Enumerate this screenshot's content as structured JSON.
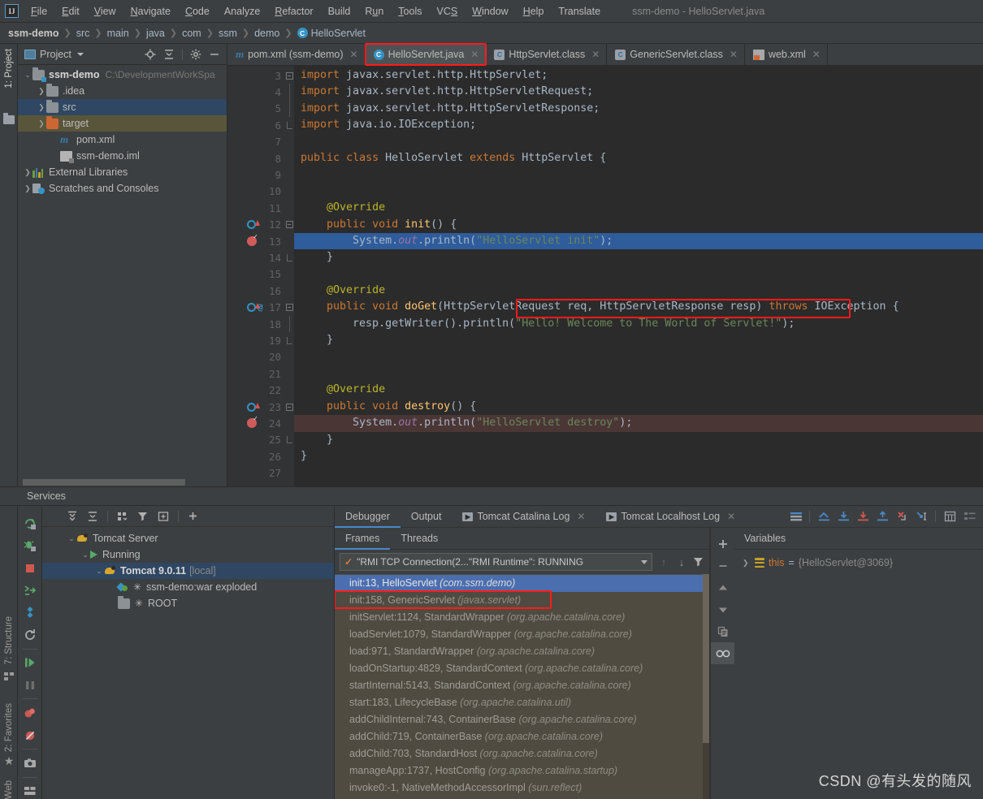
{
  "menu": {
    "logo": "IJ",
    "items": [
      "File",
      "Edit",
      "View",
      "Navigate",
      "Code",
      "Analyze",
      "Refactor",
      "Build",
      "Run",
      "Tools",
      "VCS",
      "Window",
      "Help",
      "Translate"
    ],
    "window_title": "ssm-demo - HelloServlet.java"
  },
  "breadcrumbs": {
    "items": [
      "ssm-demo",
      "src",
      "main",
      "java",
      "com",
      "ssm",
      "demo"
    ],
    "last": "HelloServlet",
    "class_icon_letter": "C"
  },
  "left_strip": {
    "project_label": "1: Project"
  },
  "project": {
    "title": "Project",
    "tree": [
      {
        "indent": 0,
        "arrow": "v",
        "icon": "module-folder",
        "name": "ssm-demo",
        "bold": true,
        "path": "C:\\DevelopmentWorkSpa",
        "state": "normal"
      },
      {
        "indent": 1,
        "arrow": ">",
        "icon": "folder",
        "name": ".idea",
        "bold": false,
        "path": "",
        "state": "normal"
      },
      {
        "indent": 1,
        "arrow": ">",
        "icon": "folder",
        "name": "src",
        "bold": false,
        "path": "",
        "state": "selected-blue"
      },
      {
        "indent": 1,
        "arrow": ">",
        "icon": "folder-orange",
        "name": "target",
        "bold": false,
        "path": "",
        "state": "selected-olive"
      },
      {
        "indent": 2,
        "arrow": "",
        "icon": "maven",
        "name": "pom.xml",
        "bold": false,
        "path": "",
        "state": "normal"
      },
      {
        "indent": 2,
        "arrow": "",
        "icon": "iml",
        "name": "ssm-demo.iml",
        "bold": false,
        "path": "",
        "state": "normal"
      },
      {
        "indent": 0,
        "arrow": ">",
        "icon": "libraries",
        "name": "External Libraries",
        "bold": false,
        "path": "",
        "state": "normal"
      },
      {
        "indent": 0,
        "arrow": ">",
        "icon": "scratches",
        "name": "Scratches and Consoles",
        "bold": false,
        "path": "",
        "state": "normal"
      }
    ]
  },
  "editor": {
    "tabs": [
      {
        "icon": "maven",
        "label": "pom.xml (ssm-demo)",
        "active": false,
        "closable": true
      },
      {
        "icon": "class-blue",
        "label": "HelloServlet.java",
        "active": true,
        "closable": true,
        "highlighted": true
      },
      {
        "icon": "class-file",
        "label": "HttpServlet.class",
        "active": false,
        "closable": true
      },
      {
        "icon": "class-file",
        "label": "GenericServlet.class",
        "active": false,
        "closable": true
      },
      {
        "icon": "xml",
        "label": "web.xml",
        "active": false,
        "closable": true
      }
    ],
    "first_visible_line": 3,
    "lines": [
      {
        "n": 3,
        "gutter": [],
        "fold": "minus",
        "highlight": "none",
        "text": "import javax.servlet.http.HttpServlet;"
      },
      {
        "n": 4,
        "gutter": [],
        "fold": "bar",
        "highlight": "none",
        "text": "import javax.servlet.http.HttpServletRequest;"
      },
      {
        "n": 5,
        "gutter": [],
        "fold": "bar",
        "highlight": "none",
        "text": "import javax.servlet.http.HttpServletResponse;"
      },
      {
        "n": 6,
        "gutter": [],
        "fold": "end",
        "highlight": "none",
        "text": "import java.io.IOException;"
      },
      {
        "n": 7,
        "gutter": [],
        "fold": "",
        "highlight": "none",
        "text": ""
      },
      {
        "n": 8,
        "gutter": [],
        "fold": "",
        "highlight": "none",
        "text": "public class HelloServlet extends HttpServlet {"
      },
      {
        "n": 9,
        "gutter": [],
        "fold": "",
        "highlight": "none",
        "text": ""
      },
      {
        "n": 10,
        "gutter": [],
        "fold": "",
        "highlight": "none",
        "text": ""
      },
      {
        "n": 11,
        "gutter": [],
        "fold": "",
        "highlight": "none",
        "text": "    @Override"
      },
      {
        "n": 12,
        "gutter": [
          "override"
        ],
        "fold": "minus",
        "highlight": "none",
        "text": "    public void init() {"
      },
      {
        "n": 13,
        "gutter": [
          "breakpoint-checked"
        ],
        "fold": "",
        "highlight": "blue",
        "text": "        System.out.println(\"HelloServlet init\");"
      },
      {
        "n": 14,
        "gutter": [],
        "fold": "end",
        "highlight": "none",
        "text": "    }"
      },
      {
        "n": 15,
        "gutter": [],
        "fold": "",
        "highlight": "none",
        "text": ""
      },
      {
        "n": 16,
        "gutter": [],
        "fold": "",
        "highlight": "none",
        "text": "    @Override"
      },
      {
        "n": 17,
        "gutter": [
          "override",
          "at"
        ],
        "fold": "minus",
        "highlight": "none",
        "text": "    public void doGet(HttpServletRequest req, HttpServletResponse resp) throws IOException {"
      },
      {
        "n": 18,
        "gutter": [],
        "fold": "bar",
        "highlight": "none",
        "text": "        resp.getWriter().println(\"Hello! Welcome to The World of Servlet!\");"
      },
      {
        "n": 19,
        "gutter": [],
        "fold": "end",
        "highlight": "none",
        "text": "    }"
      },
      {
        "n": 20,
        "gutter": [],
        "fold": "",
        "highlight": "none",
        "text": ""
      },
      {
        "n": 21,
        "gutter": [],
        "fold": "",
        "highlight": "none",
        "text": ""
      },
      {
        "n": 22,
        "gutter": [],
        "fold": "",
        "highlight": "none",
        "text": "    @Override"
      },
      {
        "n": 23,
        "gutter": [
          "override"
        ],
        "fold": "minus",
        "highlight": "none",
        "text": "    public void destroy() {"
      },
      {
        "n": 24,
        "gutter": [
          "breakpoint-checked"
        ],
        "fold": "",
        "highlight": "red",
        "text": "        System.out.println(\"HelloServlet destroy\");"
      },
      {
        "n": 25,
        "gutter": [],
        "fold": "end",
        "highlight": "none",
        "text": "    }"
      },
      {
        "n": 26,
        "gutter": [],
        "fold": "",
        "highlight": "none",
        "text": "}"
      },
      {
        "n": 27,
        "gutter": [],
        "fold": "",
        "highlight": "none",
        "text": ""
      }
    ]
  },
  "services": {
    "title": "Services",
    "tree": [
      {
        "indent": 0,
        "arrow": "v",
        "icon": "tomcat",
        "name": "Tomcat Server",
        "bold": false,
        "suffix": "",
        "selected": false
      },
      {
        "indent": 1,
        "arrow": "v",
        "icon": "play",
        "name": "Running",
        "bold": false,
        "suffix": "",
        "selected": false
      },
      {
        "indent": 2,
        "arrow": "v",
        "icon": "tomcat",
        "name": "Tomcat 9.0.11",
        "bold": true,
        "suffix": "[local]",
        "selected": true
      },
      {
        "indent": 3,
        "arrow": "",
        "icon": "war",
        "name": "ssm-demo:war exploded",
        "bold": false,
        "suffix": "",
        "selected": false
      },
      {
        "indent": 3,
        "arrow": "",
        "icon": "folder",
        "name": "ROOT",
        "bold": false,
        "suffix": "",
        "selected": false
      }
    ]
  },
  "debugger": {
    "tabs": [
      {
        "label": "Debugger",
        "icon": "",
        "active": true,
        "closable": false
      },
      {
        "label": "Output",
        "icon": "",
        "active": false,
        "closable": false
      },
      {
        "label": "Tomcat Catalina Log",
        "icon": "log",
        "active": false,
        "closable": true
      },
      {
        "label": "Tomcat Localhost Log",
        "icon": "log",
        "active": false,
        "closable": true
      }
    ],
    "sub_tabs": [
      {
        "label": "Frames",
        "active": true
      },
      {
        "label": "Threads",
        "active": false
      }
    ],
    "thread_selector": "\"RMI TCP Connection(2...\"RMI Runtime\": RUNNING",
    "frames": [
      {
        "text": "init:13, HelloServlet ",
        "pkg": "(com.ssm.demo)",
        "selected": true,
        "highlighted": true
      },
      {
        "text": "init:158, GenericServlet ",
        "pkg": "(javax.servlet)",
        "selected": false,
        "highlighted": false
      },
      {
        "text": "initServlet:1124, StandardWrapper ",
        "pkg": "(org.apache.catalina.core)",
        "selected": false,
        "highlighted": false
      },
      {
        "text": "loadServlet:1079, StandardWrapper ",
        "pkg": "(org.apache.catalina.core)",
        "selected": false,
        "highlighted": false
      },
      {
        "text": "load:971, StandardWrapper ",
        "pkg": "(org.apache.catalina.core)",
        "selected": false,
        "highlighted": false
      },
      {
        "text": "loadOnStartup:4829, StandardContext ",
        "pkg": "(org.apache.catalina.core)",
        "selected": false,
        "highlighted": false
      },
      {
        "text": "startInternal:5143, StandardContext ",
        "pkg": "(org.apache.catalina.core)",
        "selected": false,
        "highlighted": false
      },
      {
        "text": "start:183, LifecycleBase ",
        "pkg": "(org.apache.catalina.util)",
        "selected": false,
        "highlighted": false
      },
      {
        "text": "addChildInternal:743, ContainerBase ",
        "pkg": "(org.apache.catalina.core)",
        "selected": false,
        "highlighted": false
      },
      {
        "text": "addChild:719, ContainerBase ",
        "pkg": "(org.apache.catalina.core)",
        "selected": false,
        "highlighted": false
      },
      {
        "text": "addChild:703, StandardHost ",
        "pkg": "(org.apache.catalina.core)",
        "selected": false,
        "highlighted": false
      },
      {
        "text": "manageApp:1737, HostConfig ",
        "pkg": "(org.apache.catalina.startup)",
        "selected": false,
        "highlighted": false
      },
      {
        "text": "invoke0:-1, NativeMethodAccessorImpl ",
        "pkg": "(sun.reflect)",
        "selected": false,
        "highlighted": false
      }
    ],
    "variables": {
      "header": "Variables",
      "rows": [
        {
          "arrow": ">",
          "name": "this",
          "eq": "=",
          "value": "{HelloServlet@3069}"
        }
      ]
    }
  },
  "bottom_strip": {
    "structure_label": "7: Structure",
    "favorites_label": "2: Favorites",
    "web_label": "Web"
  },
  "watermark": "CSDN @有头发的随风",
  "colors": {
    "accent_blue": "#4a88c7",
    "selection_blue": "#2f5c9b",
    "frame_selection": "#4b6eaf",
    "highlight_red": "#ff1a1a",
    "keyword_orange": "#cc7832",
    "string_green": "#6a8759",
    "annotation_yellow": "#bbb529",
    "field_purple": "#9876aa",
    "method_gold": "#ffc66d",
    "bg_editor": "#2b2b2b",
    "bg_panel": "#3c3f41",
    "frames_bg": "#4f4b41"
  }
}
